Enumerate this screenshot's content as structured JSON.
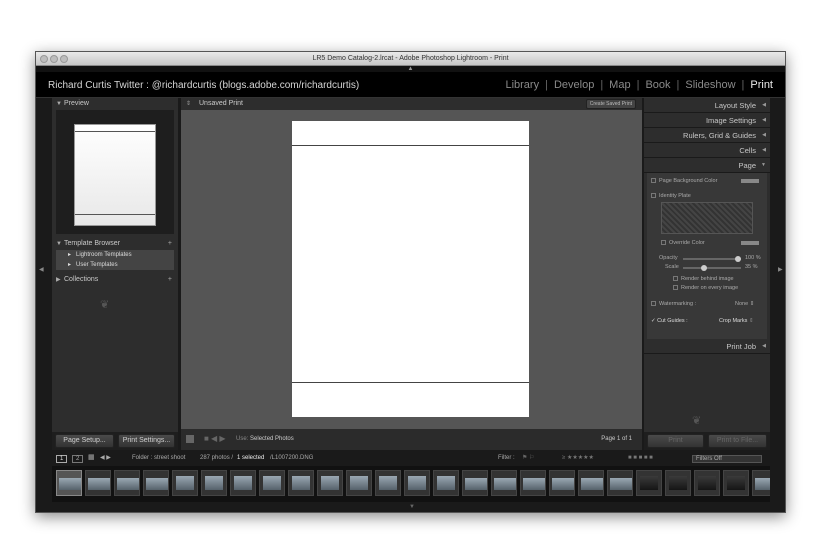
{
  "window_title": "LR5 Demo Catalog-2.lrcat - Adobe Photoshop Lightroom - Print",
  "identity": "Richard Curtis Twitter : @richardcurtis (blogs.adobe.com/richardcurtis)",
  "modules": [
    {
      "label": "Library",
      "active": false
    },
    {
      "label": "Develop",
      "active": false
    },
    {
      "label": "Map",
      "active": false
    },
    {
      "label": "Book",
      "active": false
    },
    {
      "label": "Slideshow",
      "active": false
    },
    {
      "label": "Print",
      "active": true
    }
  ],
  "left_panel": {
    "preview_label": "Preview",
    "template_browser_label": "Template Browser",
    "template_items": [
      "Lightroom Templates",
      "User Templates"
    ],
    "collections_label": "Collections",
    "page_setup_label": "Page Setup...",
    "print_settings_label": "Print Settings..."
  },
  "center": {
    "page_name": "Unsaved Print",
    "create_saved_label": "Create Saved Print",
    "use_label": "Use:",
    "use_value": "Selected Photos",
    "page_count": "Page 1 of 1"
  },
  "right_panel": {
    "sections": [
      "Layout Style",
      "Image Settings",
      "Rulers, Grid & Guides",
      "Cells",
      "Page"
    ],
    "page_bg_label": "Page Background Color",
    "identity_plate_label": "Identity Plate",
    "override_color_label": "Override Color",
    "opacity_label": "Opacity",
    "opacity_value": "100 %",
    "opacity_level": 1.0,
    "scale_label": "Scale",
    "scale_value": "35 %",
    "scale_level": 0.35,
    "render_behind_label": "Render behind image",
    "render_every_label": "Render on every image",
    "watermarking_label": "Watermarking :",
    "watermarking_value": "None",
    "cut_guides_label": "Cut Guides :",
    "cut_guides_value": "Crop Marks",
    "print_job_label": "Print Job",
    "print_label": "Print",
    "print_to_file_label": "Print to File..."
  },
  "filmstrip": {
    "monitor1": "1",
    "monitor2": "2",
    "folder": "Folder : street shoot",
    "count": "287 photos /",
    "selected": "1 selected",
    "file": "/L1007200.DNG",
    "filter_label": "Filter :",
    "filters_off": "Filters Off"
  }
}
